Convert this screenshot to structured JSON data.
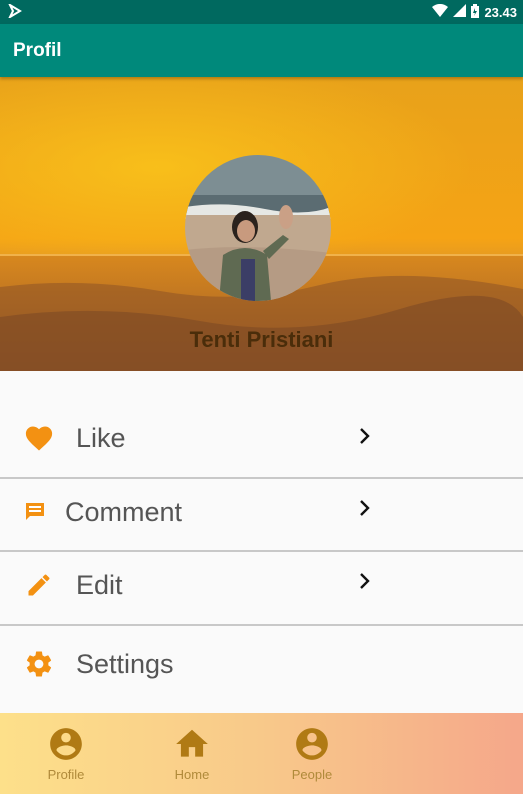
{
  "status_bar": {
    "time": "23.43"
  },
  "app_bar": {
    "title": "Profil"
  },
  "profile": {
    "name": "Tenti Pristiani"
  },
  "menu": {
    "items": [
      {
        "label": "Like",
        "icon": "heart-icon"
      },
      {
        "label": "Comment",
        "icon": "comment-icon"
      },
      {
        "label": "Edit",
        "icon": "pencil-icon"
      },
      {
        "label": "Settings",
        "icon": "gear-icon"
      }
    ]
  },
  "bottom_nav": {
    "items": [
      {
        "label": "Profile",
        "icon": "account-circle-icon"
      },
      {
        "label": "Home",
        "icon": "home-icon"
      },
      {
        "label": "People",
        "icon": "account-circle-icon"
      }
    ]
  },
  "colors": {
    "status_bar": "#00695f",
    "app_bar": "#00897b",
    "accent_icon": "#f39112",
    "nav_icon": "#b07a14"
  }
}
